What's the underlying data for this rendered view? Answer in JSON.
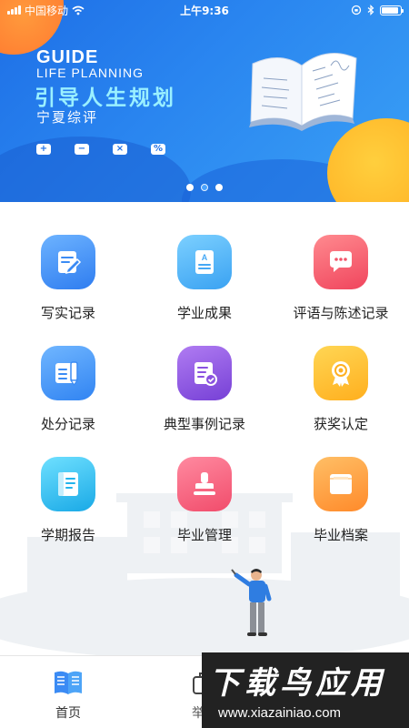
{
  "status_bar": {
    "carrier": "中国移动",
    "time": "上午9:36",
    "battery_level": 0.9
  },
  "banner": {
    "title_en": "GUIDE",
    "subtitle_en": "LIFE PLANNING",
    "headline": "引导人生规划",
    "subline": "宁夏综评",
    "math_symbols": [
      "+",
      "−",
      "×",
      "%"
    ],
    "dots": 3,
    "active_dot": 1
  },
  "grid": {
    "items": [
      {
        "label": "写实记录",
        "icon": "edit-note-icon",
        "color": "#3b8bf4"
      },
      {
        "label": "学业成果",
        "icon": "document-a-icon",
        "color": "#45a8f5"
      },
      {
        "label": "评语与陈述记录",
        "icon": "chat-bubble-icon",
        "color": "#f2556a"
      },
      {
        "label": "处分记录",
        "icon": "pen-list-icon",
        "color": "#3b8bf4"
      },
      {
        "label": "典型事例记录",
        "icon": "clipboard-check-icon",
        "color": "#8a52e0"
      },
      {
        "label": "获奖认定",
        "icon": "award-badge-icon",
        "color": "#ffbb2a"
      },
      {
        "label": "学期报告",
        "icon": "report-book-icon",
        "color": "#21b4ec"
      },
      {
        "label": "毕业管理",
        "icon": "stamp-icon",
        "color": "#f35a76"
      },
      {
        "label": "毕业档案",
        "icon": "archive-folder-icon",
        "color": "#ff9a3a"
      }
    ]
  },
  "tabbar": {
    "tabs": [
      {
        "label": "首页",
        "icon": "home-book-icon",
        "active": true
      },
      {
        "label": "举报",
        "icon": "report-briefcase-icon",
        "active": false
      }
    ]
  },
  "watermark": {
    "title": "下载鸟应用",
    "url": "www.xiazainiao.com"
  }
}
